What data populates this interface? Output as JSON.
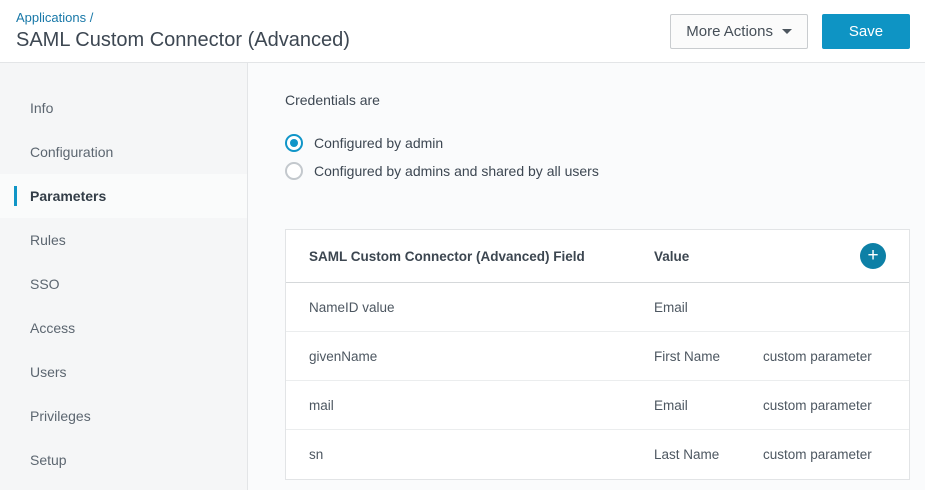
{
  "header": {
    "breadcrumb": "Applications /",
    "title": "SAML Custom Connector (Advanced)",
    "more_actions_label": "More Actions",
    "save_label": "Save"
  },
  "sidebar": {
    "items": [
      {
        "label": "Info"
      },
      {
        "label": "Configuration"
      },
      {
        "label": "Parameters",
        "active": true
      },
      {
        "label": "Rules"
      },
      {
        "label": "SSO"
      },
      {
        "label": "Access"
      },
      {
        "label": "Users"
      },
      {
        "label": "Privileges"
      },
      {
        "label": "Setup"
      }
    ]
  },
  "main": {
    "credentials_label": "Credentials are",
    "radio_options": [
      {
        "label": "Configured by admin",
        "selected": true
      },
      {
        "label": "Configured by admins and shared by all users"
      }
    ],
    "table": {
      "field_column": "SAML Custom Connector (Advanced) Field",
      "value_column": "Value",
      "add_icon": "plus-icon",
      "rows": [
        {
          "field": "NameID value",
          "value": "Email",
          "param": ""
        },
        {
          "field": "givenName",
          "value": "First Name",
          "param": "custom parameter"
        },
        {
          "field": "mail",
          "value": "Email",
          "param": "custom parameter"
        },
        {
          "field": "sn",
          "value": "Last Name",
          "param": "custom parameter"
        }
      ]
    }
  },
  "colors": {
    "accent": "#0e94c4",
    "accent_dark": "#0d80a6",
    "active_marker": "#1095c6",
    "link": "#1878a8"
  }
}
